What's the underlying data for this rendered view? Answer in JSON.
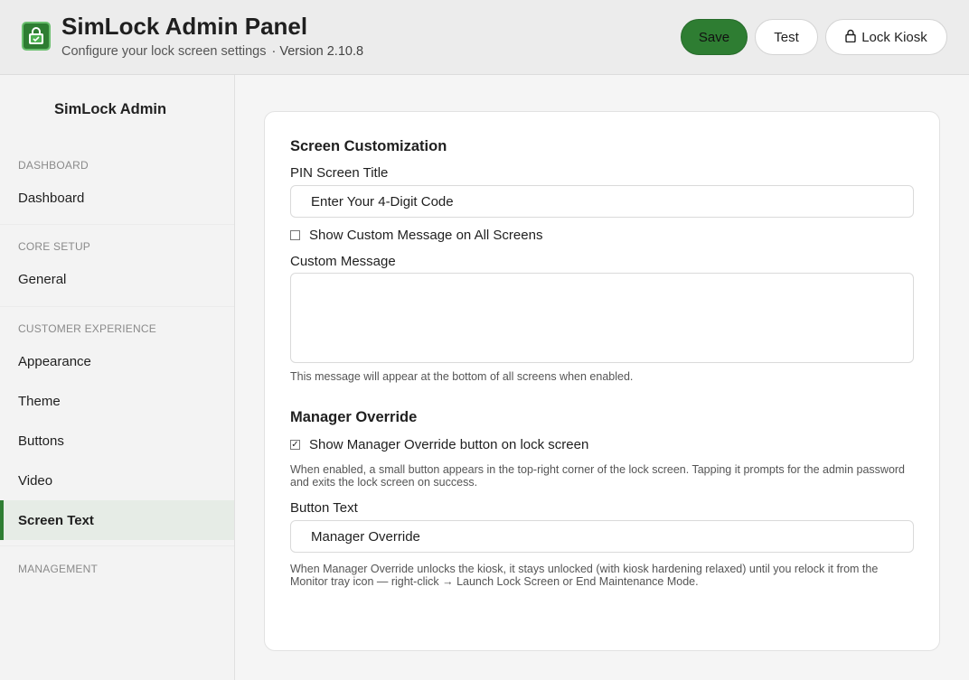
{
  "header": {
    "title": "SimLock Admin Panel",
    "subtitle": "Configure your lock screen settings",
    "version": "· Version 2.10.8",
    "buttons": {
      "save": "Save",
      "test": "Test",
      "lock_kiosk": "Lock Kiosk"
    }
  },
  "sidebar": {
    "title": "SimLock Admin",
    "sections": {
      "dashboard": "DASHBOARD",
      "core_setup": "CORE SETUP",
      "customer_experience": "CUSTOMER EXPERIENCE",
      "management": "MANAGEMENT"
    },
    "items": {
      "dashboard": "Dashboard",
      "general": "General",
      "appearance": "Appearance",
      "theme": "Theme",
      "buttons": "Buttons",
      "video": "Video",
      "screen_text": "Screen Text"
    },
    "active_item": "Screen Text"
  },
  "main": {
    "screen_customization": {
      "heading": "Screen Customization",
      "pin_title_label": "PIN Screen Title",
      "pin_title_value": "Enter Your 4-Digit Code",
      "show_custom_message_label": "Show Custom Message on All Screens",
      "show_custom_message_checked": false,
      "custom_message_label": "Custom Message",
      "custom_message_value": "",
      "custom_message_help": "This message will appear at the bottom of all screens when enabled."
    },
    "manager_override": {
      "heading": "Manager Override",
      "show_button_label": "Show Manager Override button on lock screen",
      "show_button_checked": true,
      "show_button_help": "When enabled, a small button appears in the top-right corner of the lock screen. Tapping it prompts for the admin password and exits the lock screen on success.",
      "button_text_label": "Button Text",
      "button_text_value": "Manager Override",
      "footer_help": "When Manager Override unlocks the kiosk, it stays unlocked (with kiosk hardening relaxed) until you relock it from the Monitor tray icon — right-click → Launch Lock Screen or End Maintenance Mode."
    }
  },
  "colors": {
    "accent": "#2e7d32",
    "active_bg": "#e6ece6",
    "header_bg": "#ececec",
    "sidebar_bg": "#f3f3f3"
  },
  "icons": {
    "app_logo": "lock-bag-icon",
    "lock_button": "padlock-icon",
    "checkbox_checked": "✓"
  }
}
